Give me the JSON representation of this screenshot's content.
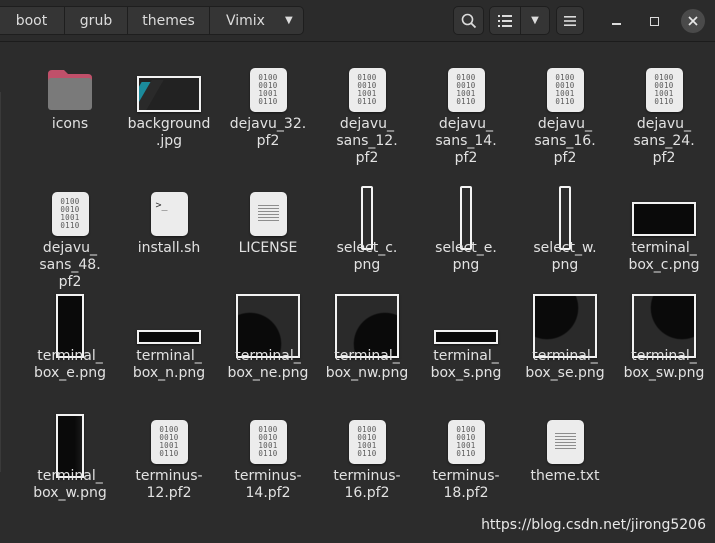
{
  "breadcrumb": [
    "boot",
    "grub",
    "themes",
    "Vimix"
  ],
  "toolbar": {
    "search": "search-icon",
    "view": "list-view-icon",
    "view_options": "chevron-down-icon",
    "menu": "hamburger-menu-icon"
  },
  "window": {
    "minimize": "minimize-icon",
    "maximize": "maximize-icon",
    "close": "close-icon"
  },
  "files": [
    {
      "label": "icons",
      "kind": "folder"
    },
    {
      "label": "background\n.jpg",
      "kind": "image-background"
    },
    {
      "label": "dejavu_32.\npf2",
      "kind": "binary"
    },
    {
      "label": "dejavu_\nsans_12.\npf2",
      "kind": "binary"
    },
    {
      "label": "dejavu_\nsans_14.\npf2",
      "kind": "binary"
    },
    {
      "label": "dejavu_\nsans_16.\npf2",
      "kind": "binary"
    },
    {
      "label": "dejavu_\nsans_24.\npf2",
      "kind": "binary"
    },
    {
      "label": "dejavu_\nsans_48.\npf2",
      "kind": "binary"
    },
    {
      "label": "install.sh",
      "kind": "script"
    },
    {
      "label": "LICENSE",
      "kind": "text"
    },
    {
      "label": "select_c.\npng",
      "kind": "vbar"
    },
    {
      "label": "select_e.\npng",
      "kind": "vbar"
    },
    {
      "label": "select_w.\npng",
      "kind": "vbar"
    },
    {
      "label": "terminal_\nbox_c.png",
      "kind": "box-c"
    },
    {
      "label": "terminal_\nbox_e.png",
      "kind": "box-e"
    },
    {
      "label": "terminal_\nbox_n.png",
      "kind": "box-n"
    },
    {
      "label": "terminal_\nbox_ne.png",
      "kind": "box-ne"
    },
    {
      "label": "terminal_\nbox_nw.png",
      "kind": "box-nw"
    },
    {
      "label": "terminal_\nbox_s.png",
      "kind": "box-n"
    },
    {
      "label": "terminal_\nbox_se.png",
      "kind": "box-se"
    },
    {
      "label": "terminal_\nbox_sw.png",
      "kind": "box-sw"
    },
    {
      "label": "terminal_\nbox_w.png",
      "kind": "box-w"
    },
    {
      "label": "terminus-\n12.pf2",
      "kind": "binary"
    },
    {
      "label": "terminus-\n14.pf2",
      "kind": "binary"
    },
    {
      "label": "terminus-\n16.pf2",
      "kind": "binary"
    },
    {
      "label": "terminus-\n18.pf2",
      "kind": "binary"
    },
    {
      "label": "theme.txt",
      "kind": "text"
    }
  ],
  "binary_glyph": "0100\n0010\n1001\n0110",
  "script_glyph": ">_",
  "watermark": "https://blog.csdn.net/jirong5206",
  "colors": {
    "background": "#2c2c2c",
    "folder": "#7a7a7a",
    "folder_tab": "#c0506a",
    "close_button": "#4a4a4a"
  }
}
